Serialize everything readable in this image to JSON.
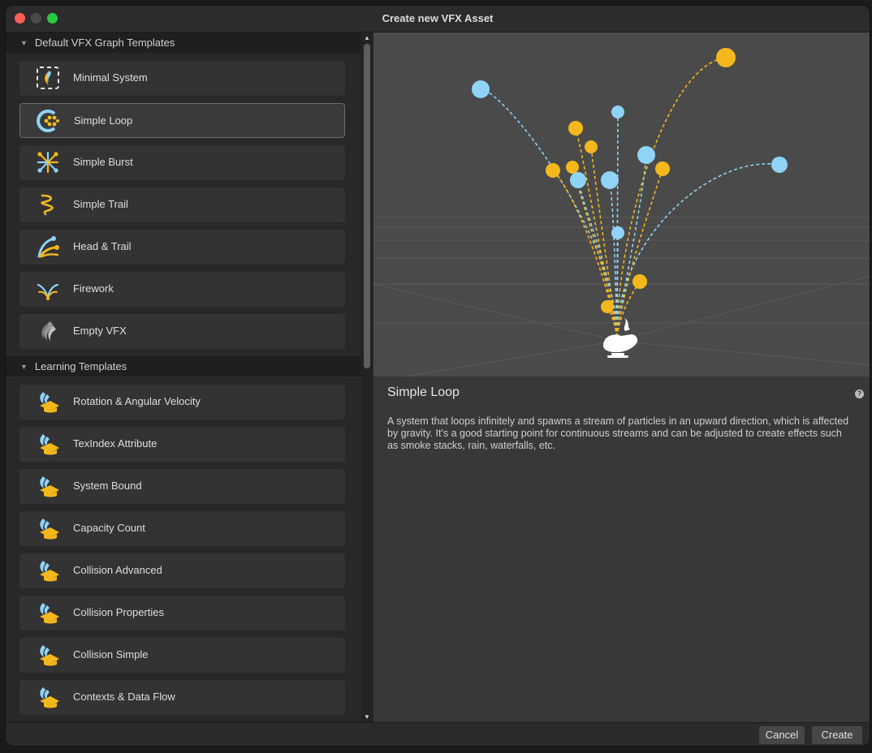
{
  "window": {
    "title": "Create new VFX Asset"
  },
  "sections": [
    {
      "header": "Default VFX Graph Templates",
      "items": [
        {
          "label": "Minimal System",
          "icon": "minimal-system-icon"
        },
        {
          "label": "Simple Loop",
          "icon": "simple-loop-icon",
          "selected": true
        },
        {
          "label": "Simple Burst",
          "icon": "simple-burst-icon"
        },
        {
          "label": "Simple Trail",
          "icon": "simple-trail-icon"
        },
        {
          "label": "Head & Trail",
          "icon": "head-trail-icon"
        },
        {
          "label": "Firework",
          "icon": "firework-icon"
        },
        {
          "label": "Empty VFX",
          "icon": "empty-vfx-icon"
        }
      ]
    },
    {
      "header": "Learning Templates",
      "items": [
        {
          "label": "Rotation & Angular Velocity",
          "icon": "learning-template-icon"
        },
        {
          "label": "TexIndex Attribute",
          "icon": "learning-template-icon"
        },
        {
          "label": "System Bound",
          "icon": "learning-template-icon"
        },
        {
          "label": "Capacity Count",
          "icon": "learning-template-icon"
        },
        {
          "label": "Collision Advanced",
          "icon": "learning-template-icon"
        },
        {
          "label": "Collision Properties",
          "icon": "learning-template-icon"
        },
        {
          "label": "Collision Simple",
          "icon": "learning-template-icon"
        },
        {
          "label": "Contexts & Data Flow",
          "icon": "learning-template-icon"
        }
      ]
    }
  ],
  "detail": {
    "title": "Simple Loop",
    "description": "A system that loops infinitely and spawns a stream of particles in an upward direction, which is affected by gravity. It's a good starting point for continuous streams and can be adjusted to create effects such as smoke stacks, rain, waterfalls, etc."
  },
  "buttons": {
    "cancel": "Cancel",
    "create": "Create"
  },
  "colors": {
    "accent_yellow": "#f5b81c",
    "accent_blue": "#8fd3f7",
    "panel": "#383838",
    "preview_bg": "#4a4a4a"
  }
}
